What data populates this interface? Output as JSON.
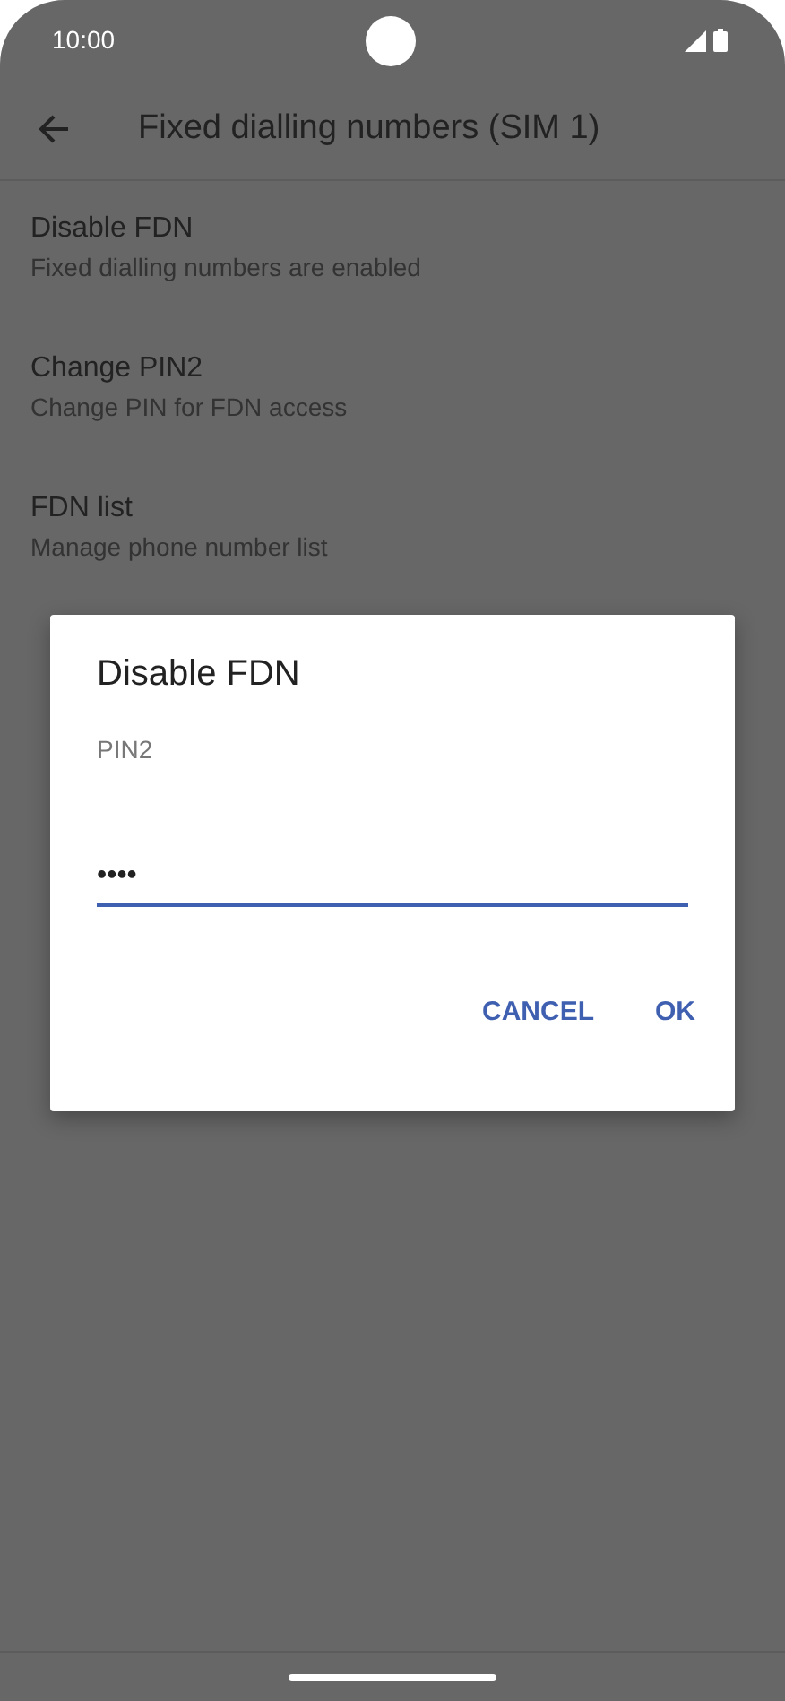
{
  "status_bar": {
    "time": "10:00"
  },
  "toolbar": {
    "title": "Fixed dialling numbers (SIM 1)"
  },
  "settings": [
    {
      "title": "Disable FDN",
      "subtitle": "Fixed dialling numbers are enabled"
    },
    {
      "title": "Change PIN2",
      "subtitle": "Change PIN for FDN access"
    },
    {
      "title": "FDN list",
      "subtitle": "Manage phone number list"
    }
  ],
  "dialog": {
    "title": "Disable FDN",
    "field_label": "PIN2",
    "value": "••••",
    "buttons": [
      "CANCEL",
      "OK"
    ]
  }
}
